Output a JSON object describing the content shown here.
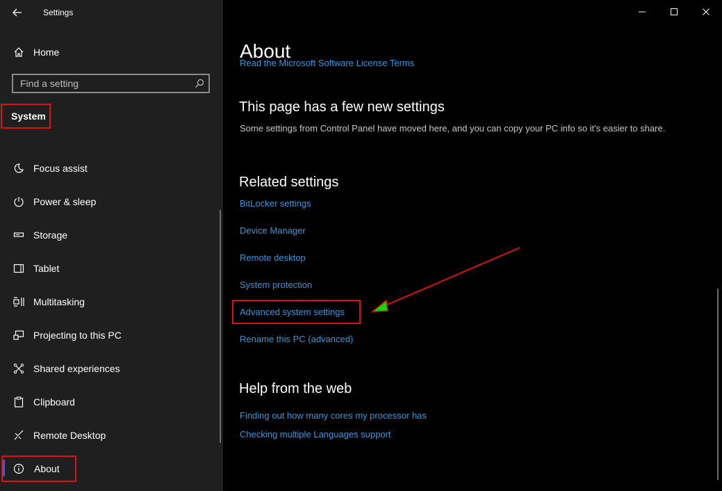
{
  "window": {
    "title": "Settings",
    "controls": [
      "minimize",
      "maximize",
      "close"
    ]
  },
  "sidebar": {
    "home_label": "Home",
    "search": {
      "placeholder": "Find a setting",
      "value": ""
    },
    "section_title": "System",
    "items": [
      {
        "label": "Focus assist",
        "icon": "moon-icon"
      },
      {
        "label": "Power & sleep",
        "icon": "power-icon"
      },
      {
        "label": "Storage",
        "icon": "storage-icon"
      },
      {
        "label": "Tablet",
        "icon": "tablet-icon"
      },
      {
        "label": "Multitasking",
        "icon": "multitasking-icon"
      },
      {
        "label": "Projecting to this PC",
        "icon": "projecting-icon"
      },
      {
        "label": "Shared experiences",
        "icon": "shared-icon"
      },
      {
        "label": "Clipboard",
        "icon": "clipboard-icon"
      },
      {
        "label": "Remote Desktop",
        "icon": "remote-desktop-icon"
      },
      {
        "label": "About",
        "icon": "info-icon",
        "selected": true
      }
    ]
  },
  "main": {
    "title": "About",
    "clipped_link": "Read the Microsoft Software License Terms",
    "new_settings": {
      "heading": "This page has a few new settings",
      "description": "Some settings from Control Panel have moved here, and you can copy your PC info so it's easier to share."
    },
    "related": {
      "heading": "Related settings",
      "links": [
        "BitLocker settings",
        "Device Manager",
        "Remote desktop",
        "System protection",
        "Advanced system settings",
        "Rename this PC (advanced)"
      ]
    },
    "help": {
      "heading": "Help from the web",
      "links": [
        "Finding out how many cores my processor has",
        "Checking multiple Languages support"
      ]
    }
  },
  "colors": {
    "sidebar_bg": "#1f1f1f",
    "main_bg": "#000000",
    "link": "#3a96dd",
    "highlight_box": "#e01010",
    "annotation_arrow": "#e01010",
    "annotation_head": "#00e000"
  }
}
